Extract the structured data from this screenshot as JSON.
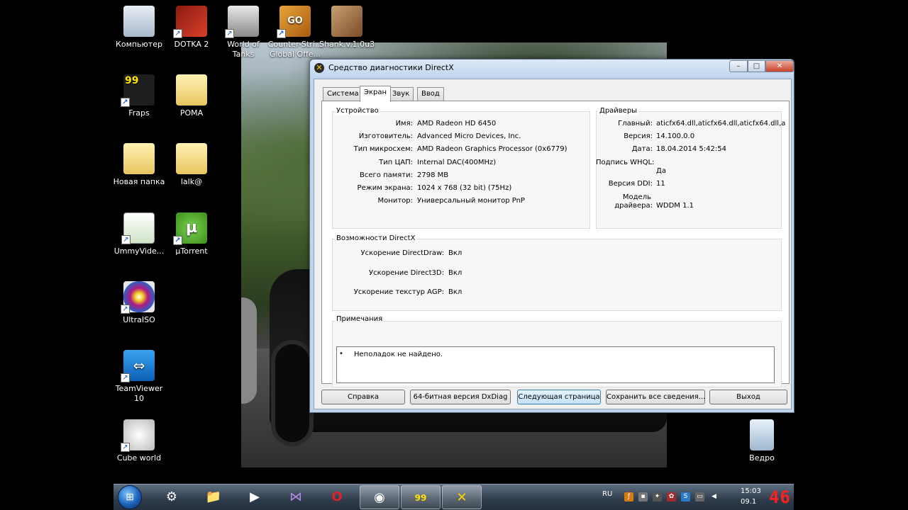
{
  "desktop": {
    "icons": [
      {
        "label": "Компьютер",
        "icon": "computer-icon"
      },
      {
        "label": "DOTKA 2",
        "icon": "dota2-icon"
      },
      {
        "label": "World of Tanks",
        "icon": "world-of-tanks-icon"
      },
      {
        "label": "Counter-Stri... Global Offe...",
        "icon": "csgo-icon",
        "badge": "GO"
      },
      {
        "label": "Shank.v.1.0u3",
        "icon": "shank-icon"
      },
      {
        "label": "Fraps",
        "icon": "fraps-icon",
        "badge": "99"
      },
      {
        "label": "POMA",
        "icon": "folder-icon"
      },
      {
        "label": "Новая папка",
        "icon": "folder-icon"
      },
      {
        "label": "lalk@",
        "icon": "folder-icon"
      },
      {
        "label": "UmmyVide...",
        "icon": "ummy-video-icon"
      },
      {
        "label": "µTorrent",
        "icon": "utorrent-icon",
        "badge": "µ"
      },
      {
        "label": "UltraISO",
        "icon": "ultraiso-icon"
      },
      {
        "label": "TeamViewer 10",
        "icon": "teamviewer-icon"
      },
      {
        "label": "Cube world",
        "icon": "cube-world-icon"
      },
      {
        "label": "Ведро",
        "icon": "recycle-bin-icon"
      }
    ]
  },
  "window": {
    "title": "Средство диагностики DirectX",
    "controls": {
      "minimize": "–",
      "maximize": "□",
      "close": "✕"
    },
    "tabs": [
      {
        "label": "Система"
      },
      {
        "label": "Экран",
        "active": true
      },
      {
        "label": "Звук"
      },
      {
        "label": "Ввод"
      }
    ],
    "device": {
      "title": "Устройство",
      "rows": [
        {
          "label": "Имя:",
          "value": "AMD Radeon HD 6450"
        },
        {
          "label": "Изготовитель:",
          "value": "Advanced Micro Devices, Inc."
        },
        {
          "label": "Тип микросхем:",
          "value": "AMD Radeon Graphics Processor (0x6779)"
        },
        {
          "label": "Тип ЦАП:",
          "value": "Internal DAC(400MHz)"
        },
        {
          "label": "Всего памяти:",
          "value": "2798 MB"
        },
        {
          "label": "Режим экрана:",
          "value": "1024 x 768 (32 bit) (75Hz)"
        },
        {
          "label": "Монитор:",
          "value": "Универсальный монитор PnP"
        }
      ]
    },
    "drivers": {
      "title": "Драйверы",
      "rows": [
        {
          "label": "Главный:",
          "value": "aticfx64.dll,aticfx64.dll,aticfx64.dll,a"
        },
        {
          "label": "Версия:",
          "value": "14.100.0.0"
        },
        {
          "label": "Дата:",
          "value": "18.04.2014 5:42:54"
        },
        {
          "label": "Подпись WHQL:",
          "value": "Да"
        },
        {
          "label": "Версия DDI:",
          "value": "11"
        },
        {
          "label_line1": "Модель",
          "label_line2": "драйвера:",
          "value": "WDDM 1.1"
        }
      ]
    },
    "features": {
      "title": "Возможности DirectX",
      "rows": [
        {
          "label": "Ускорение DirectDraw:",
          "value": "Вкл"
        },
        {
          "label": "Ускорение Direct3D:",
          "value": "Вкл"
        },
        {
          "label": "Ускорение текстур AGP:",
          "value": "Вкл"
        }
      ]
    },
    "notes": {
      "title": "Примечания",
      "bullet": "•",
      "text": "Неполадок не найдено."
    },
    "buttons": {
      "help": "Справка",
      "dxdiag64": "64-битная версия DxDiag",
      "next_page": "Следующая страница",
      "save_all": "Сохранить все сведения...",
      "exit": "Выход"
    }
  },
  "taskbar": {
    "language": "RU",
    "clock_time": "15:03",
    "clock_date": "09.1",
    "pinned": [
      "windows-start-orb-icon",
      "steam-icon",
      "file-explorer-icon",
      "media-player-icon",
      "visual-studio-icon",
      "opera-icon",
      "chrome-icon",
      "fraps-icon",
      "directx-icon"
    ]
  },
  "fraps_counter": "46"
}
